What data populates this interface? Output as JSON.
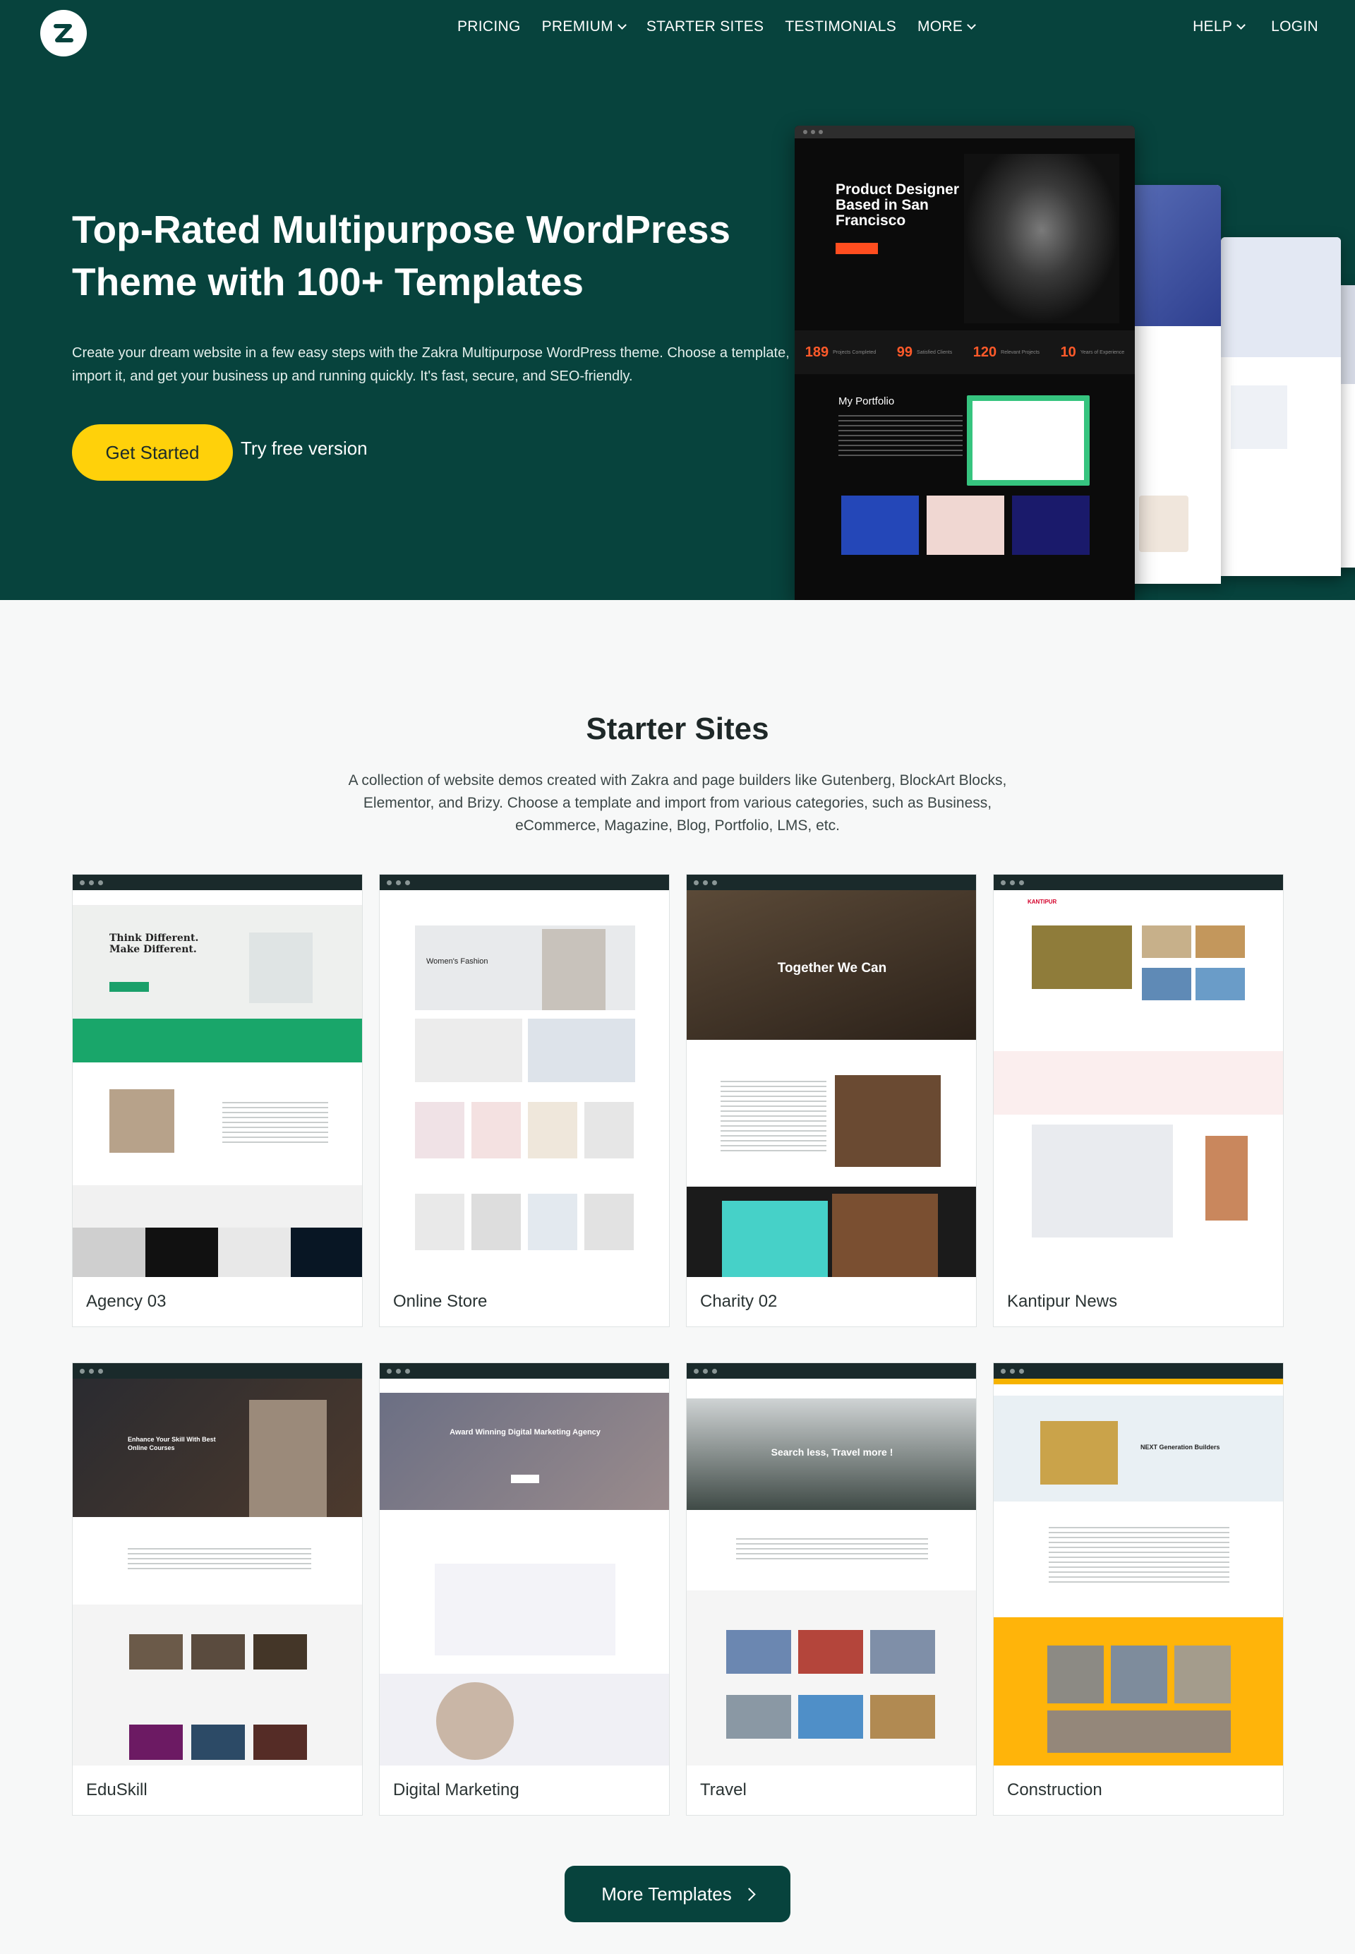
{
  "nav": {
    "logo_alt": "Zakra",
    "items": [
      {
        "label": "PRICING"
      },
      {
        "label": "PREMIUM"
      },
      {
        "label": "STARTER SITES"
      },
      {
        "label": "TESTIMONIALS"
      },
      {
        "label": "MORE"
      }
    ],
    "help": "HELP",
    "login": "LOGIN"
  },
  "hero": {
    "title": "Top-Rated Multipurpose WordPress Theme with 100+ Templates",
    "description": "Create your dream website in a few easy steps with the Zakra Multipurpose WordPress theme. Choose a template, import it, and get your business up and running quickly. It's fast, secure, and SEO-friendly.",
    "cta_primary": "Get Started",
    "cta_secondary": "Try free version",
    "mockup": {
      "heading": "Product Designer Based in San Francisco",
      "stats": [
        {
          "value": "189",
          "label": "Projects Completed"
        },
        {
          "value": "99",
          "label": "Satisfied Clients"
        },
        {
          "value": "120",
          "label": "Relevant Projects"
        },
        {
          "value": "10",
          "label": "Years of Experience"
        }
      ],
      "portfolio_label": "My Portfolio"
    }
  },
  "starter": {
    "title": "Starter Sites",
    "description": "A collection of website demos created with Zakra and page builders like Gutenberg, BlockArt Blocks, Elementor, and Brizy. Choose a template and import from various categories, such as Business, eCommerce, Magazine, Blog, Portfolio, LMS, etc.",
    "cards": [
      {
        "name": "Agency 03",
        "preview_text": "Think Different. Make Different."
      },
      {
        "name": "Online Store",
        "preview_text": "Women's Fashion"
      },
      {
        "name": "Charity 02",
        "preview_text": "Together We Can"
      },
      {
        "name": "Kantipur News",
        "preview_text": "KANTIPUR"
      },
      {
        "name": "EduSkill",
        "preview_text": "Enhance Your Skill With Best Online Courses"
      },
      {
        "name": "Digital Marketing",
        "preview_text": "Award Winning Digital Marketing Agency"
      },
      {
        "name": "Travel",
        "preview_text": "Search less, Travel more !"
      },
      {
        "name": "Construction",
        "preview_text": "NEXT Generation Builders"
      }
    ],
    "more_button": "More Templates"
  },
  "colors": {
    "brand_dark_green": "#07433d",
    "accent_yellow": "#ffd10a",
    "accent_orange": "#ff4d1f"
  }
}
